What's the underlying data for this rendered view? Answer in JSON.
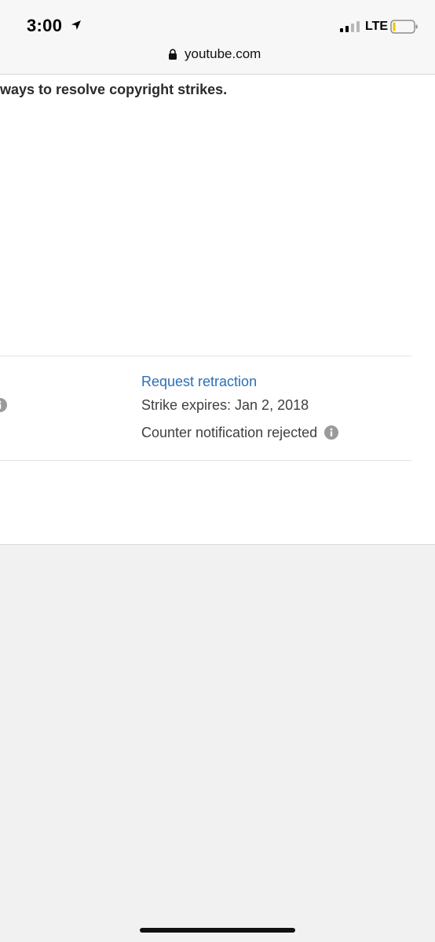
{
  "status_bar": {
    "time": "3:00",
    "network": "LTE",
    "icons": [
      "location-arrow-icon",
      "signal-bars-icon",
      "battery-icon"
    ]
  },
  "browser": {
    "url": "youtube.com",
    "icons": [
      "lock-icon"
    ]
  },
  "page": {
    "intro_text": "ways to resolve copyright strikes.",
    "strike_row": {
      "request_retraction": "Request retraction",
      "expires": "Strike expires: Jan 2, 2018",
      "counter_status": "Counter notification rejected",
      "icons": [
        "info-icon"
      ]
    }
  },
  "colors": {
    "link": "#2c6fb7",
    "page_bg": "#ffffff",
    "canvas_bg": "#f1f1f1",
    "status_bar_bg": "#f7f7f7"
  }
}
